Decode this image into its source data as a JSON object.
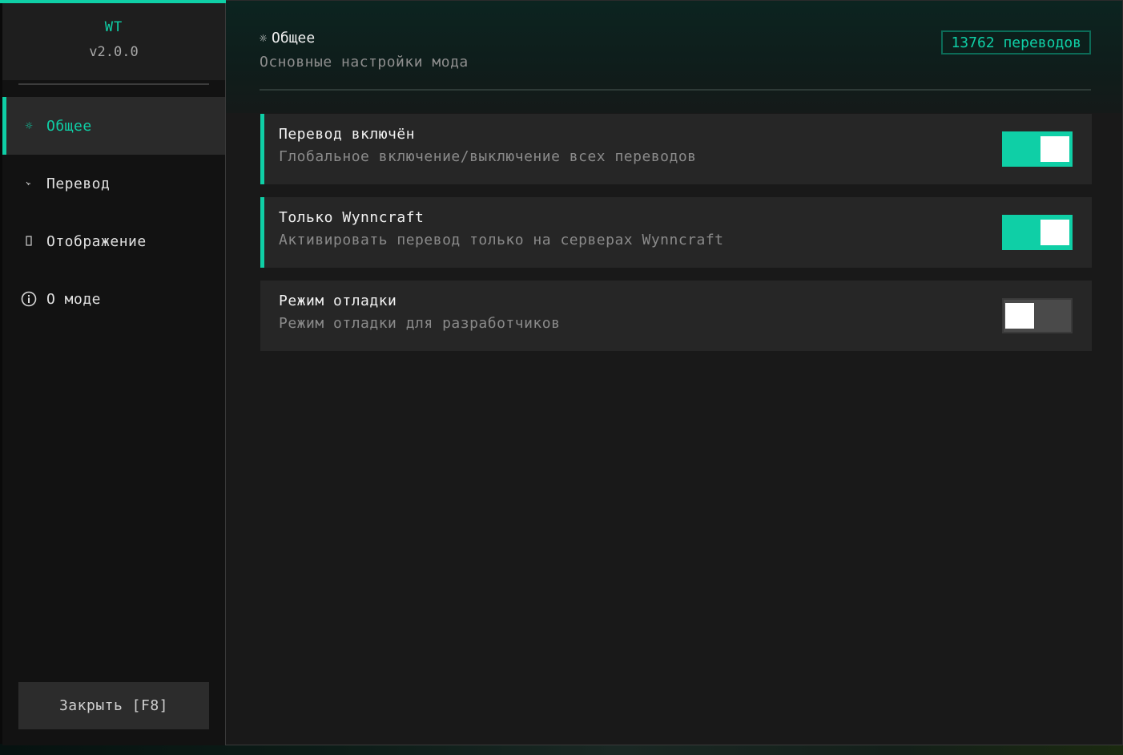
{
  "app": {
    "logo": "WT",
    "version": "v2.0.0"
  },
  "sidebar": {
    "items": [
      {
        "label": "Общее",
        "icon": "gear-icon",
        "active": true
      },
      {
        "label": "Перевод",
        "icon": "translate-icon",
        "active": false
      },
      {
        "label": "Отображение",
        "icon": "display-icon",
        "active": false
      },
      {
        "label": "О моде",
        "icon": "info-icon",
        "active": false
      }
    ],
    "close_label": "Закрыть [F8]"
  },
  "header": {
    "title": "Общее",
    "subtitle": "Основные настройки мода",
    "count_badge": "13762 переводов"
  },
  "settings": [
    {
      "title": "Перевод включён",
      "description": "Глобальное включение/выключение всех переводов",
      "enabled": true
    },
    {
      "title": "Только Wynncraft",
      "description": "Активировать перевод только на серверах Wynncraft",
      "enabled": true
    },
    {
      "title": "Режим отладки",
      "description": "Режим отладки для разработчиков",
      "enabled": false
    }
  ],
  "colors": {
    "accent": "#0fcfa6",
    "panel": "#191919",
    "sidebar": "#121212",
    "card": "#262626"
  }
}
